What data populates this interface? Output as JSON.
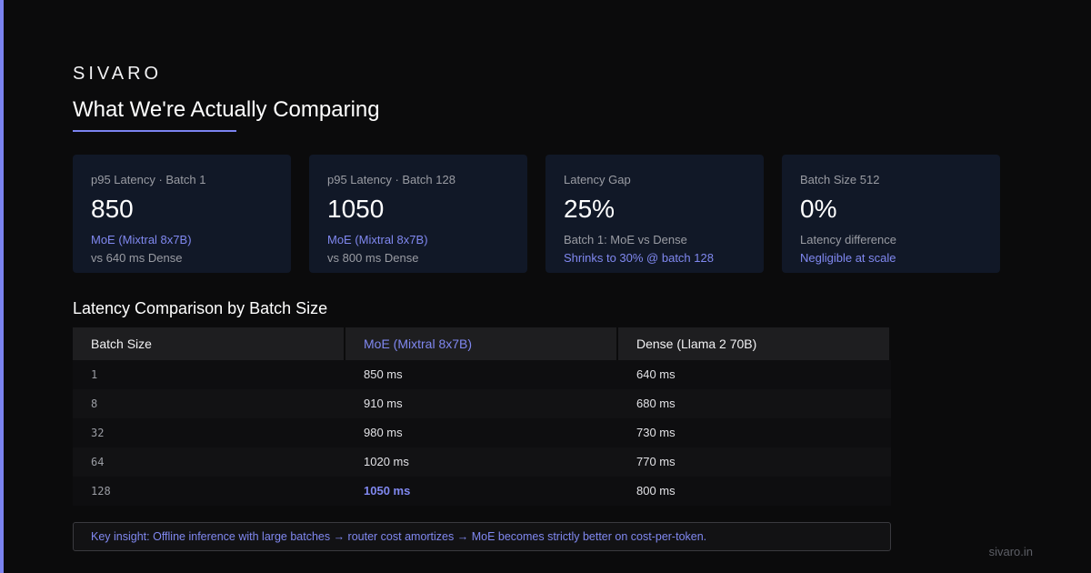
{
  "brand": "SIVARO",
  "page_title": "What We're Actually Comparing",
  "cards": [
    {
      "label": "p95 Latency · Batch 1",
      "value": "850",
      "sub1": "MoE (Mixtral 8x7B)",
      "sub2": "vs 640 ms Dense"
    },
    {
      "label": "p95 Latency · Batch 128",
      "value": "1050",
      "sub1": "MoE (Mixtral 8x7B)",
      "sub2": "vs 800 ms Dense"
    },
    {
      "label": "Latency Gap",
      "value": "25%",
      "sub1": "Batch 1: MoE vs Dense",
      "sub2": "Shrinks to 30% @ batch 128"
    },
    {
      "label": "Batch Size 512",
      "value": "0%",
      "sub1": "Latency difference",
      "sub2": "Negligible at scale"
    }
  ],
  "section_title": "Latency Comparison by Batch Size",
  "table": {
    "headers": [
      "Batch Size",
      "MoE (Mixtral 8x7B)",
      "Dense (Llama 2 70B)"
    ],
    "rows": [
      [
        "1",
        "850 ms",
        "640 ms"
      ],
      [
        "8",
        "910 ms",
        "680 ms"
      ],
      [
        "32",
        "980 ms",
        "730 ms"
      ],
      [
        "64",
        "1020 ms",
        "770 ms"
      ],
      [
        "128",
        "1050 ms",
        "800 ms"
      ]
    ]
  },
  "insight": "Key insight: Offline inference with large batches → router cost amortizes → MoE becomes strictly better on cost-per-token.",
  "footer": "sivaro.in",
  "colors": {
    "accent": "#7b83f0",
    "background": "#0b0b0c",
    "card": "#111827"
  }
}
